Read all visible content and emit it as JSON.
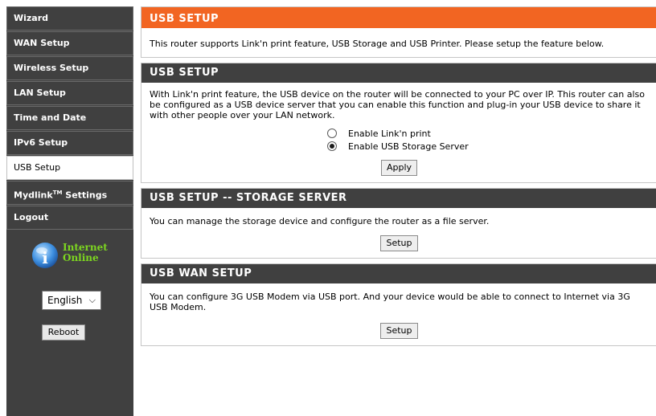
{
  "sidebar": {
    "items": [
      {
        "label": "Wizard"
      },
      {
        "label": "WAN Setup"
      },
      {
        "label": "Wireless Setup"
      },
      {
        "label": "LAN Setup"
      },
      {
        "label": "Time and Date"
      },
      {
        "label": "IPv6 Setup"
      },
      {
        "label": "USB Setup",
        "active": true
      },
      {
        "label_pre": "Mydlink",
        "label_sup": "TM",
        "label_post": " Settings"
      },
      {
        "label": "Logout"
      }
    ],
    "status_line1": "Internet",
    "status_line2": "Online",
    "status_color": "#7dd620",
    "language": "English",
    "reboot_label": "Reboot"
  },
  "intro": {
    "title": "USB SETUP",
    "text": "This router supports Link'n print feature, USB Storage and USB Printer. Please setup the feature below."
  },
  "usb_setup": {
    "title": "USB SETUP",
    "text": "With Link'n print feature, the USB device on the router will be connected to your PC over IP. This router can also be configured as a USB device server that you can enable this function and plug-in your USB device to share it with other people over your LAN network.",
    "options": [
      {
        "label": "Enable Link'n print",
        "checked": false
      },
      {
        "label": "Enable USB Storage Server",
        "checked": true
      }
    ],
    "apply_label": "Apply"
  },
  "storage_server": {
    "title": "USB SETUP -- STORAGE SERVER",
    "text": "You can manage the storage device and configure the router as a file server.",
    "setup_label": "Setup"
  },
  "usb_wan": {
    "title": "USB WAN SETUP",
    "text": "You can configure 3G USB Modem via USB port. And your device would be able to connect to Internet via 3G USB Modem.",
    "setup_label": "Setup"
  },
  "colors": {
    "header_orange": "#f26522",
    "header_dark": "#404040"
  }
}
